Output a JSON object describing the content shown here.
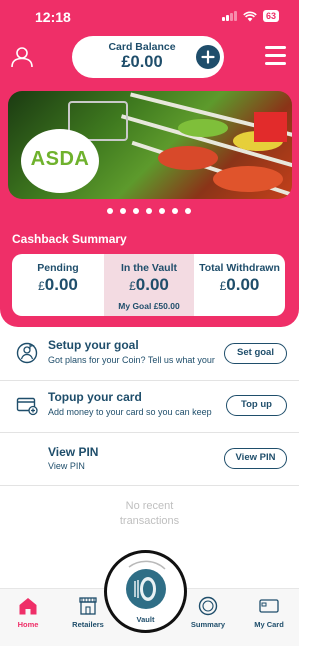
{
  "status_bar": {
    "time": "12:18",
    "battery": "63"
  },
  "header": {
    "balance_label": "Card Balance",
    "balance_value": "£0.00"
  },
  "banner": {
    "brand": "ASDA",
    "pagination_dots": 7
  },
  "cashback": {
    "title": "Cashback Summary",
    "currency_symbol": "£",
    "pending": {
      "label": "Pending",
      "value": "0.00"
    },
    "vault": {
      "label": "In the Vault",
      "value": "0.00",
      "goal": "My Goal £50.00"
    },
    "withdrawn": {
      "label": "Total Withdrawn",
      "value": "0.00"
    }
  },
  "actions": [
    {
      "title": "Setup your goal",
      "subtitle": "Got plans for your Coin? Tell us what your",
      "button": "Set goal"
    },
    {
      "title": "Topup your card",
      "subtitle": "Add money to your card so you can keep",
      "button": "Top up"
    },
    {
      "title": "View PIN",
      "subtitle": "View PIN",
      "button": "View PIN"
    }
  ],
  "transactions": {
    "empty_line1": "No recent",
    "empty_line2": "transactions"
  },
  "tabs": [
    {
      "label": "Home",
      "active": true
    },
    {
      "label": "Retailers"
    },
    {
      "label": "Vault"
    },
    {
      "label": "Summary"
    },
    {
      "label": "My Card"
    }
  ],
  "colors": {
    "brand_pink": "#ef2f68",
    "navy": "#1f4e6b",
    "asda_green": "#6fb22d",
    "vault_highlight": "#f3dbe2"
  }
}
